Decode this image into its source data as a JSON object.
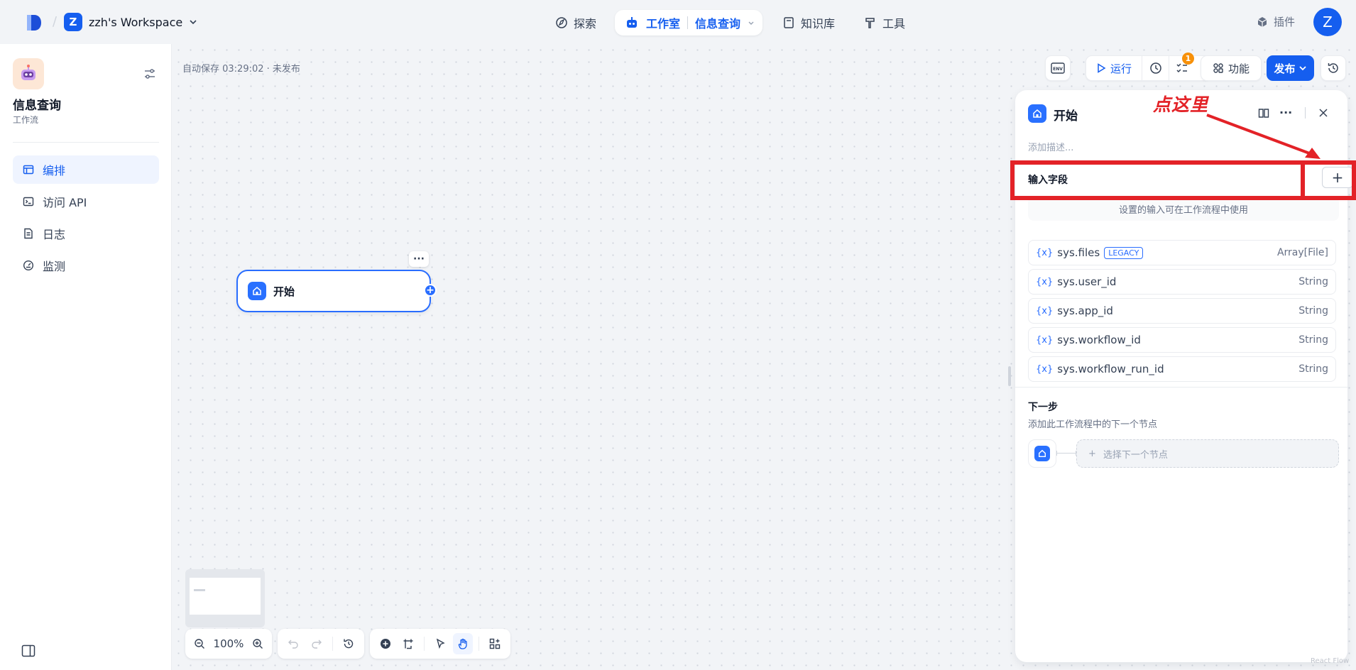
{
  "topbar": {
    "workspace_initial": "Z",
    "workspace_name": "zzh's Workspace",
    "nav_explore": "探索",
    "nav_studio": "工作室",
    "nav_current_app": "信息查询",
    "nav_knowledge": "知识库",
    "nav_tools": "工具",
    "plugins": "插件",
    "avatar_initial": "Z"
  },
  "sidebar": {
    "app_name": "信息查询",
    "app_type": "工作流",
    "items": [
      {
        "label": "编排",
        "icon": "layout-icon",
        "active": true
      },
      {
        "label": "访问 API",
        "icon": "terminal-icon",
        "active": false
      },
      {
        "label": "日志",
        "icon": "log-icon",
        "active": false
      },
      {
        "label": "监测",
        "icon": "monitor-icon",
        "active": false
      }
    ]
  },
  "canvas": {
    "autosave": "自动保存 03:29:02 · 未发布",
    "env_label": "ENV",
    "run_label": "运行",
    "checklist_count": "1",
    "features_label": "功能",
    "publish_label": "发布",
    "node_title": "开始",
    "zoom": "100%"
  },
  "panel": {
    "title": "开始",
    "description_placeholder": "添加描述...",
    "input_fields_label": "输入字段",
    "add_symbol": "+",
    "hint": "设置的输入可在工作流程中使用",
    "variables": [
      {
        "name": "sys.files",
        "badge": "LEGACY",
        "type": "Array[File]"
      },
      {
        "name": "sys.user_id",
        "badge": "",
        "type": "String"
      },
      {
        "name": "sys.app_id",
        "badge": "",
        "type": "String"
      },
      {
        "name": "sys.workflow_id",
        "badge": "",
        "type": "String"
      },
      {
        "name": "sys.workflow_run_id",
        "badge": "",
        "type": "String"
      }
    ],
    "next_step_title": "下一步",
    "next_step_desc": "添加此工作流程中的下一个节点",
    "select_next_node": "选择下一个节点"
  },
  "annotation": {
    "text": "点这里",
    "color": "#e32227"
  },
  "corner_text": "React Flow",
  "colors": {
    "accent": "#155eef",
    "annotation": "#e32227",
    "badge": "#f79009"
  }
}
